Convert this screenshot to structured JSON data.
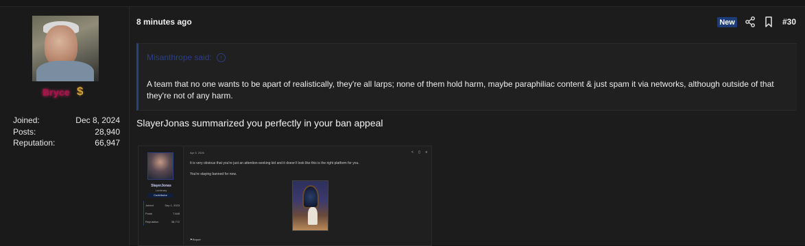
{
  "author": {
    "username": "Bryce",
    "flair_icon": "dollar-sign-icon",
    "stats": [
      {
        "label": "Joined:",
        "value": "Dec 8, 2024"
      },
      {
        "label": "Posts:",
        "value": "28,940"
      },
      {
        "label": "Reputation:",
        "value": "66,947"
      }
    ]
  },
  "post": {
    "time": "8 minutes ago",
    "badge": "New",
    "number": "#30",
    "quote": {
      "author_line": "Misanthrope said:",
      "text": "A team that no one wants to be apart of realistically, they're all larps; none of them hold harm, maybe paraphiliac content & just spam it via networks, although outside of that they're not of any harm."
    },
    "body": "SlayerJonas summarized you perfectly in your ban appeal",
    "attachment": {
      "username": "SlayerJonas",
      "role": "Luminary",
      "banner": "Contributor",
      "stats": [
        {
          "label": "Joined",
          "value": "Sep 1, 2023"
        },
        {
          "label": "Posts",
          "value": "7,648"
        },
        {
          "label": "Reputation",
          "value": "38,772"
        }
      ],
      "date": "Apr 5, 2026",
      "line1": "It is very obvious that you're just an attention-seeking kid and it doesn't look like this is the right platform for you.",
      "line2": "You're staying banned for now.",
      "report": "Report"
    }
  },
  "colors": {
    "username": "#a8124d",
    "quote_accent": "#2b3f86",
    "badge_bg": "#1f3c7a"
  }
}
